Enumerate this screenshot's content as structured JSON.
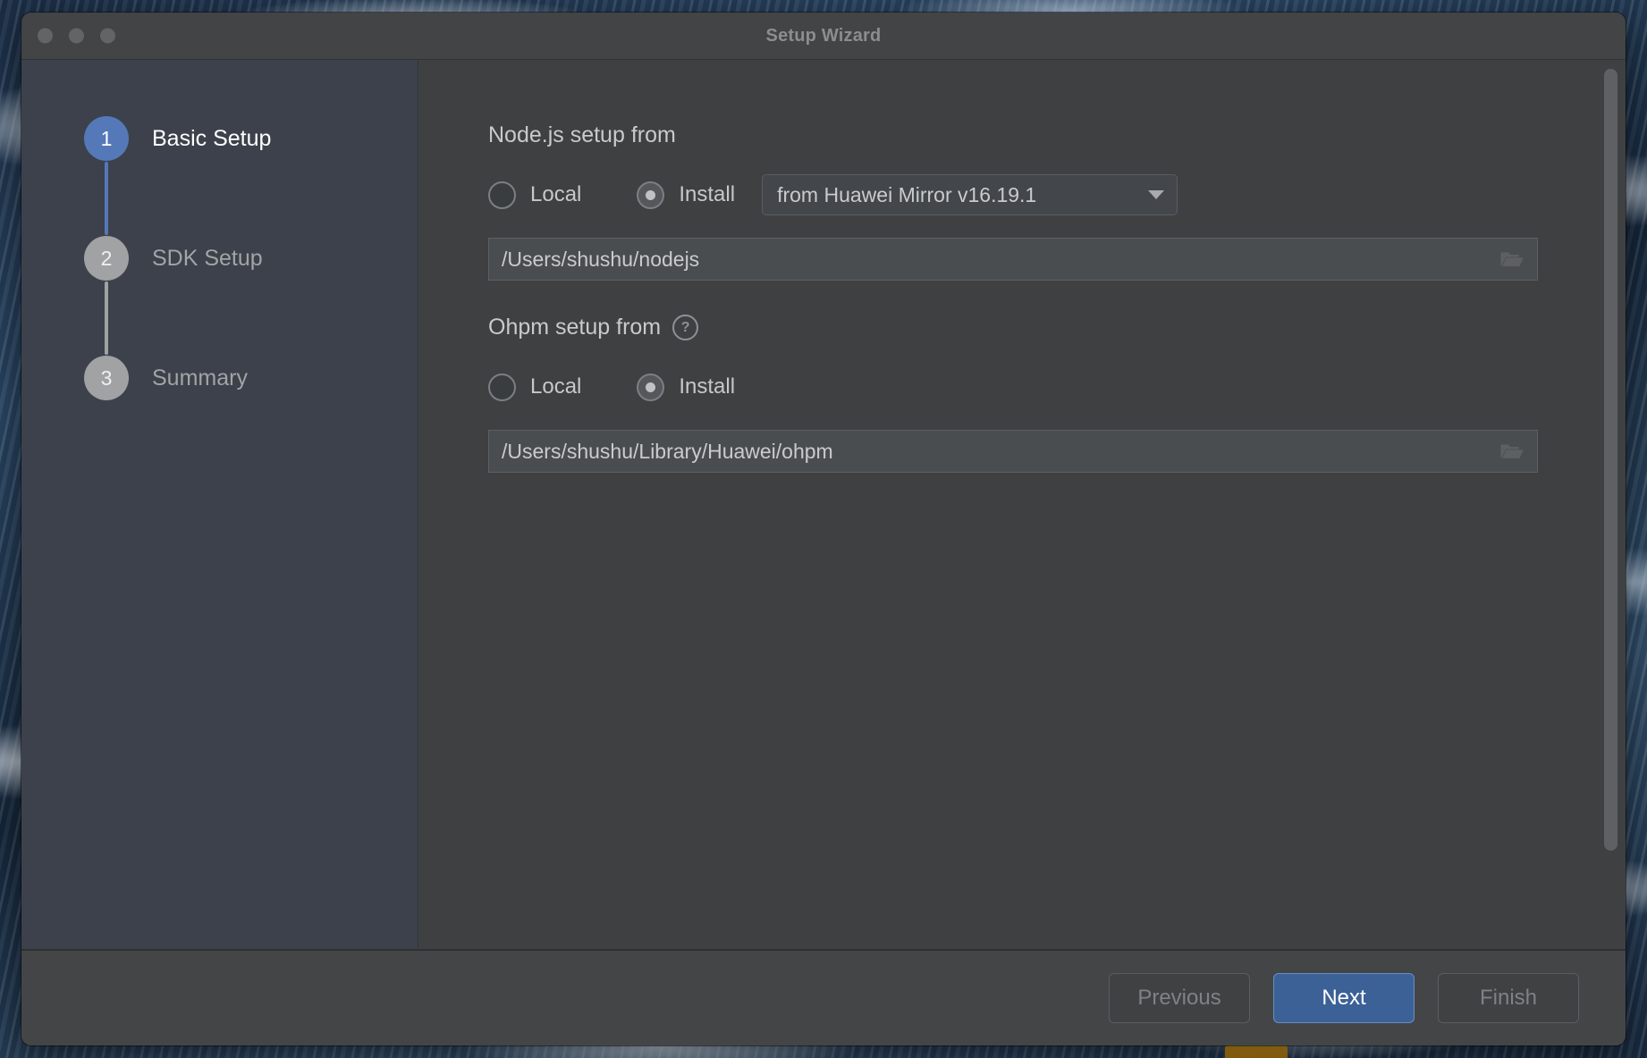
{
  "window": {
    "title": "Setup Wizard",
    "traffic_lights": [
      "close",
      "minimize",
      "zoom"
    ]
  },
  "sidebar": {
    "steps": [
      {
        "number": "1",
        "label": "Basic Setup",
        "state": "active"
      },
      {
        "number": "2",
        "label": "SDK Setup",
        "state": "inactive"
      },
      {
        "number": "3",
        "label": "Summary",
        "state": "inactive"
      }
    ]
  },
  "main": {
    "nodejs": {
      "title": "Node.js setup from",
      "local_label": "Local",
      "install_label": "Install",
      "selected": "Install",
      "mirror_value": "from Huawei Mirror v16.19.1",
      "path_value": "/Users/shushu/nodejs",
      "browse_icon": "folder-open-icon"
    },
    "ohpm": {
      "title": "Ohpm setup from",
      "help_icon": "help-circle-icon",
      "help_glyph": "?",
      "local_label": "Local",
      "install_label": "Install",
      "selected": "Install",
      "path_value": "/Users/shushu/Library/Huawei/ohpm",
      "browse_icon": "folder-open-icon"
    }
  },
  "footer": {
    "previous_label": "Previous",
    "previous_enabled": false,
    "next_label": "Next",
    "next_enabled": true,
    "finish_label": "Finish",
    "finish_enabled": false
  },
  "colors": {
    "accent_blue": "#5578b8",
    "primary_button": "#3c6197",
    "sidebar_bg": "#3c414b",
    "content_bg": "#3f4042",
    "titlebar_bg": "#424445"
  }
}
